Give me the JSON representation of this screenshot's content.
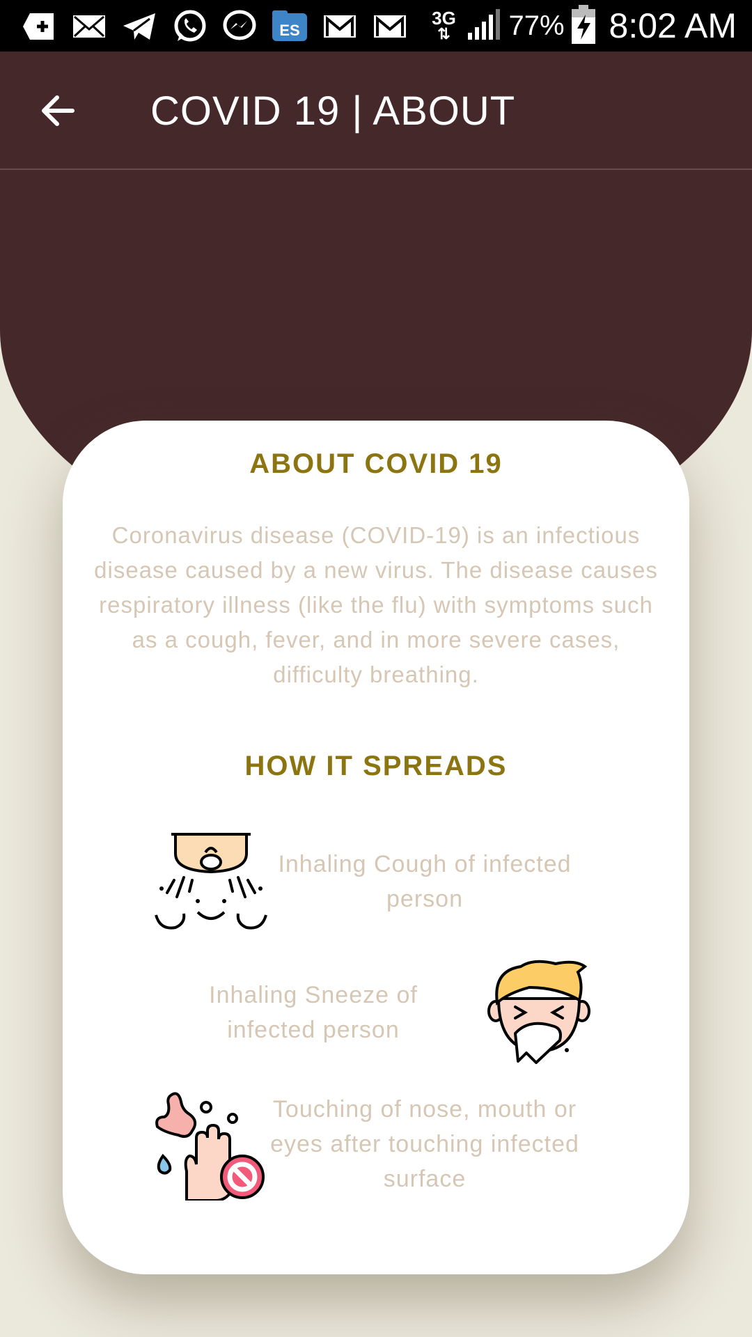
{
  "status_bar": {
    "network": "3G",
    "battery": "77%",
    "time": "8:02 AM",
    "notification_icons": [
      "add-icon",
      "mail-icon",
      "telegram-icon",
      "whatsapp-icon",
      "messenger-icon",
      "file-explorer-icon",
      "gmail-icon",
      "gmail-icon"
    ]
  },
  "app_bar": {
    "title": "COVID 19 | ABOUT"
  },
  "about": {
    "heading": "ABOUT COVID 19",
    "body": "Coronavirus disease (COVID-19) is an infectious disease caused by a new virus. The disease causes respiratory illness (like the flu) with symptoms such as a cough, fever, and in more severe cases, difficulty breathing."
  },
  "spread": {
    "heading": "HOW IT SPREADS",
    "items": [
      {
        "text": "Inhaling Cough of infected person",
        "icon": "cough-icon"
      },
      {
        "text": "Inhaling Sneeze of infected person",
        "icon": "sneeze-icon"
      },
      {
        "text": "Touching of nose, mouth or eyes after touching infected surface",
        "icon": "no-touch-icon"
      }
    ]
  },
  "colors": {
    "app_bar": "#45282a",
    "background": "#ebe8dc",
    "heading": "#8c7510",
    "body_text": "#d6c6b4"
  }
}
